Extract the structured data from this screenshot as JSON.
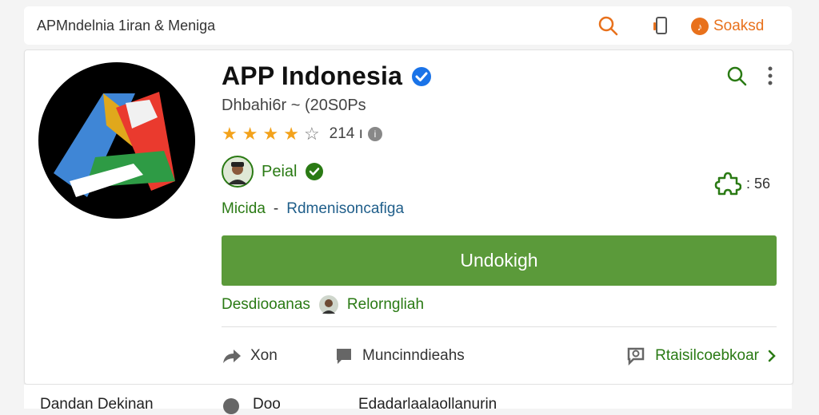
{
  "topbar": {
    "breadcrumb": "APΜndelnia 1iran & Meniga",
    "search_icon": "search-icon",
    "phone_icon": "phone-icon",
    "sound_label": "Soaksd",
    "accent": "#e8711c"
  },
  "app": {
    "title": "APP Indonesia",
    "subtitle": "Dhbahi6r ~ (20S0Ps",
    "rating_stars_filled": 4,
    "rating_stars_total": 5,
    "rating_count": "214 ı",
    "developer_name": "Peial",
    "tag_primary": "Micida",
    "tag_separator": "-",
    "tag_secondary": "Rdmenisoncafiga",
    "puzzle_count": ": 56"
  },
  "install_button": {
    "label": "Undokigh",
    "color": "#5b9a3a"
  },
  "below": {
    "left_label": "Desdiooanas",
    "right_label": "Relorngliah"
  },
  "actions": {
    "share_label": "Xon",
    "message_label": "Muncinndieahs",
    "review_label": "Rtaisilcoebkoar"
  },
  "bottom": {
    "left": "Dandan Dekinan",
    "middle": "Doo",
    "right": "Edadarlaalaollanurin"
  }
}
